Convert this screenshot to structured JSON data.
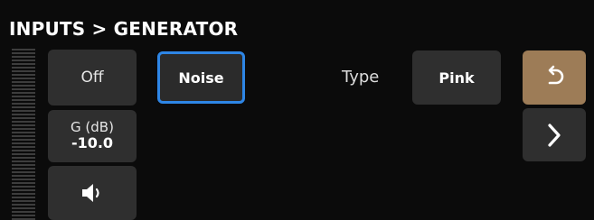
{
  "header": {
    "breadcrumb": "INPUTS > GENERATOR"
  },
  "controls": {
    "power_label": "Off",
    "gain_label": "G (dB)",
    "gain_value": "-10.0",
    "speaker_icon": "speaker-icon",
    "source_label": "Noise",
    "type_label": "Type",
    "type_value": "Pink",
    "back_icon": "undo-arrow-icon",
    "next_icon": "chevron-right-icon"
  },
  "colors": {
    "background": "#0b0b0b",
    "button": "#2f2f2f",
    "selected_border": "#2e86e6",
    "back_button": "#9d7c57"
  }
}
